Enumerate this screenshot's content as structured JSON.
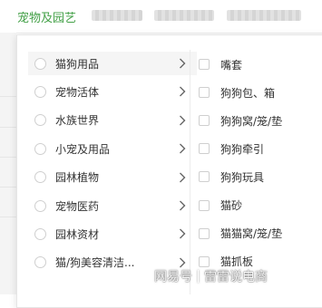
{
  "topnav": {
    "active_tab": "宠物及园艺"
  },
  "categories": [
    {
      "label": "猫狗用品",
      "selected": true
    },
    {
      "label": "宠物活体",
      "selected": false
    },
    {
      "label": "水族世界",
      "selected": false
    },
    {
      "label": "小宠及用品",
      "selected": false
    },
    {
      "label": "园林植物",
      "selected": false
    },
    {
      "label": "宠物医药",
      "selected": false
    },
    {
      "label": "园林资材",
      "selected": false
    },
    {
      "label": "猫/狗美容清洁...",
      "selected": false
    }
  ],
  "subcategories": [
    {
      "label": "嘴套"
    },
    {
      "label": "狗狗包、箱"
    },
    {
      "label": "狗狗窝/笼/垫"
    },
    {
      "label": "狗狗牵引"
    },
    {
      "label": "狗狗玩具"
    },
    {
      "label": "猫砂"
    },
    {
      "label": "猫猫窝/笼/垫"
    },
    {
      "label": "猫抓板"
    }
  ],
  "watermark": {
    "source": "网易号",
    "author": "雷雷说电商"
  },
  "colors": {
    "accent_green": "#43a047",
    "selected_bg": "#f5f5f5",
    "border": "#e5e5e5"
  },
  "icons": {
    "category_arrow": "chevron-right-icon"
  }
}
